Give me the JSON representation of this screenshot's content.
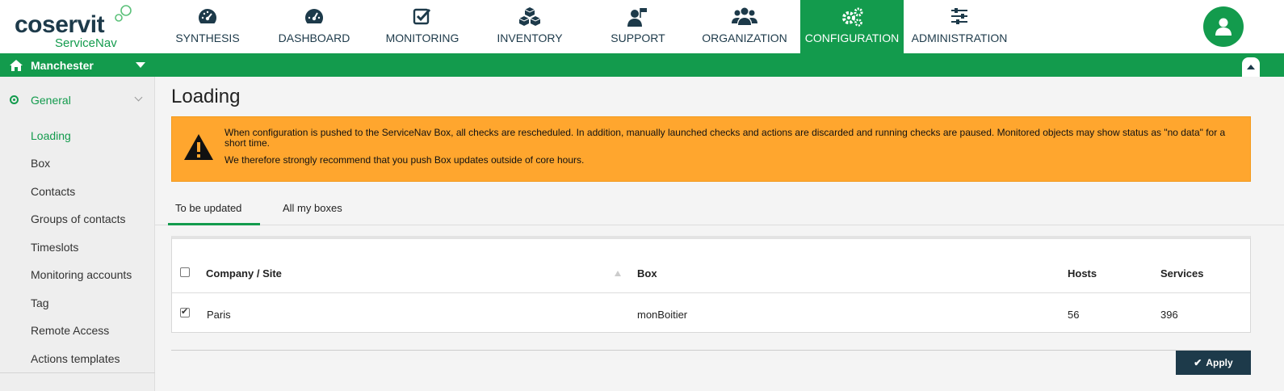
{
  "brand": {
    "name": "coservit",
    "product": "ServiceNav"
  },
  "nav": [
    {
      "label": "SYNTHESIS",
      "icon": "gauge-icon"
    },
    {
      "label": "DASHBOARD",
      "icon": "dashboard-icon"
    },
    {
      "label": "MONITORING",
      "icon": "checkbox-icon"
    },
    {
      "label": "INVENTORY",
      "icon": "cubes-icon"
    },
    {
      "label": "SUPPORT",
      "icon": "user-flag-icon"
    },
    {
      "label": "ORGANIZATION",
      "icon": "users-icon"
    },
    {
      "label": "CONFIGURATION",
      "icon": "gears-icon",
      "active": true
    },
    {
      "label": "ADMINISTRATION",
      "icon": "sliders-icon"
    }
  ],
  "site": {
    "name": "Manchester"
  },
  "sidebar": {
    "group": "General",
    "items": [
      {
        "label": "Loading",
        "active": true
      },
      {
        "label": "Box"
      },
      {
        "label": "Contacts"
      },
      {
        "label": "Groups of contacts"
      },
      {
        "label": "Timeslots"
      },
      {
        "label": "Monitoring accounts"
      },
      {
        "label": "Tag"
      },
      {
        "label": "Remote Access"
      },
      {
        "label": "Actions templates"
      }
    ]
  },
  "page": {
    "title": "Loading"
  },
  "alert": {
    "line1": "When configuration is pushed to the ServiceNav Box, all checks are rescheduled. In addition, manually launched checks and actions are discarded and running checks are paused. Monitored objects may show status as \"no data\" for a short time.",
    "line2": "We therefore strongly recommend that you push Box updates outside of core hours."
  },
  "tabs": [
    {
      "label": "To be updated",
      "active": true
    },
    {
      "label": "All my boxes"
    }
  ],
  "table": {
    "headers": {
      "company_site": "Company / Site",
      "box": "Box",
      "hosts": "Hosts",
      "services": "Services"
    },
    "rows": [
      {
        "checked": true,
        "company_site": "Paris",
        "box": "monBoitier",
        "hosts": "56",
        "services": "396"
      }
    ]
  },
  "actions": {
    "apply": "Apply"
  },
  "colors": {
    "accent": "#139b4d",
    "navy": "#1d3a4a",
    "warning": "#ffa62e"
  }
}
